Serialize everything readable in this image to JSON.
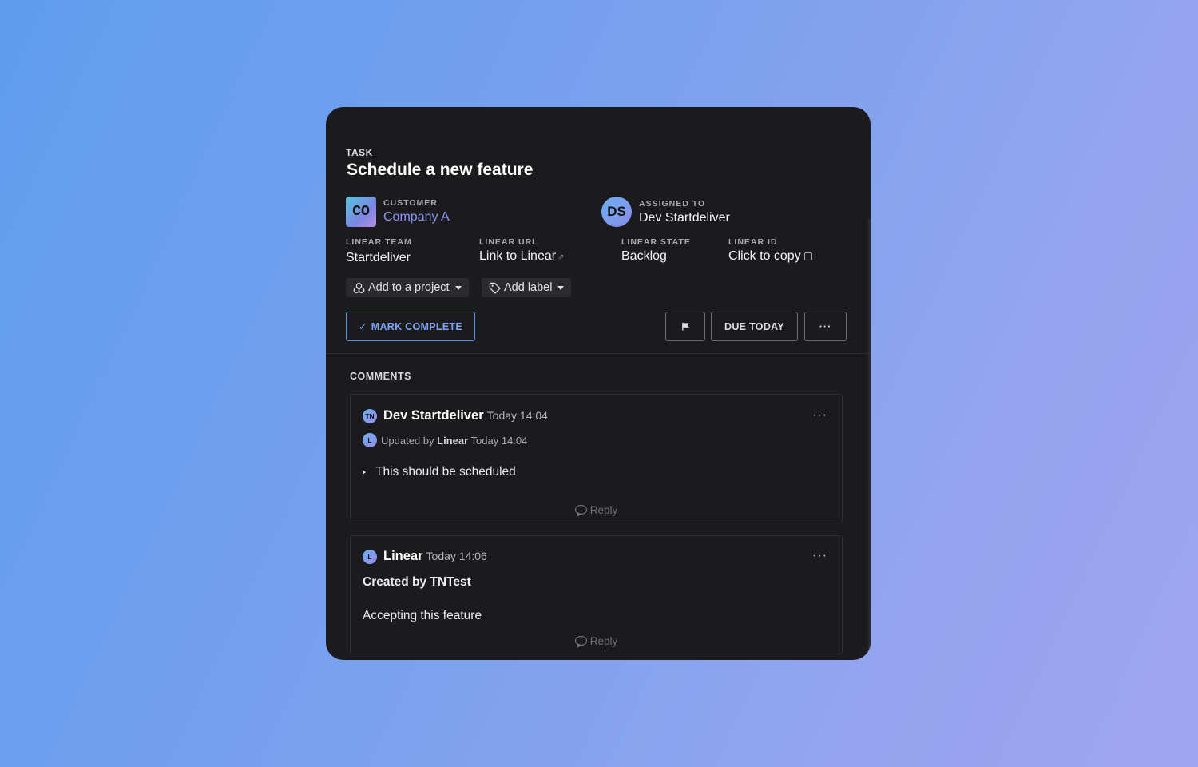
{
  "task": {
    "kicker": "TASK",
    "title": "Schedule a new feature"
  },
  "customer": {
    "avatar_initials": "CO",
    "label": "CUSTOMER",
    "value": "Company A"
  },
  "assigned": {
    "avatar_initials": "DS",
    "label": "ASSIGNED TO",
    "value": "Dev Startdeliver"
  },
  "fields": {
    "team": {
      "label": "LINEAR TEAM",
      "value": "Startdeliver"
    },
    "url": {
      "label": "LINEAR URL",
      "value": "Link to Linear"
    },
    "state": {
      "label": "LINEAR STATE",
      "value": "Backlog"
    },
    "id": {
      "label": "LINEAR ID",
      "value": "Click to copy"
    }
  },
  "pills": {
    "project": "Add to a project",
    "label": "Add label"
  },
  "actions": {
    "mark_complete": "MARK COMPLETE",
    "due": "DUE TODAY",
    "more": "···"
  },
  "comments": {
    "title": "COMMENTS",
    "items": [
      {
        "avatar": "TN",
        "author": "Dev Startdeliver",
        "time": "Today 14:04",
        "updated_prefix": "Updated by",
        "updated_avatar": "L",
        "updated_by": "Linear",
        "updated_time": "Today 14:04",
        "body": "This should be scheduled",
        "reply": "Reply",
        "more": "···"
      },
      {
        "avatar": "L",
        "author": "Linear",
        "time": "Today 14:06",
        "heading": "Created by TNTest",
        "body": "Accepting this feature",
        "reply": "Reply",
        "more": "···"
      }
    ]
  },
  "colors": {
    "accent": "#5b8ff0",
    "link": "#8a97f7",
    "card_bg": "#1b1b1e"
  }
}
